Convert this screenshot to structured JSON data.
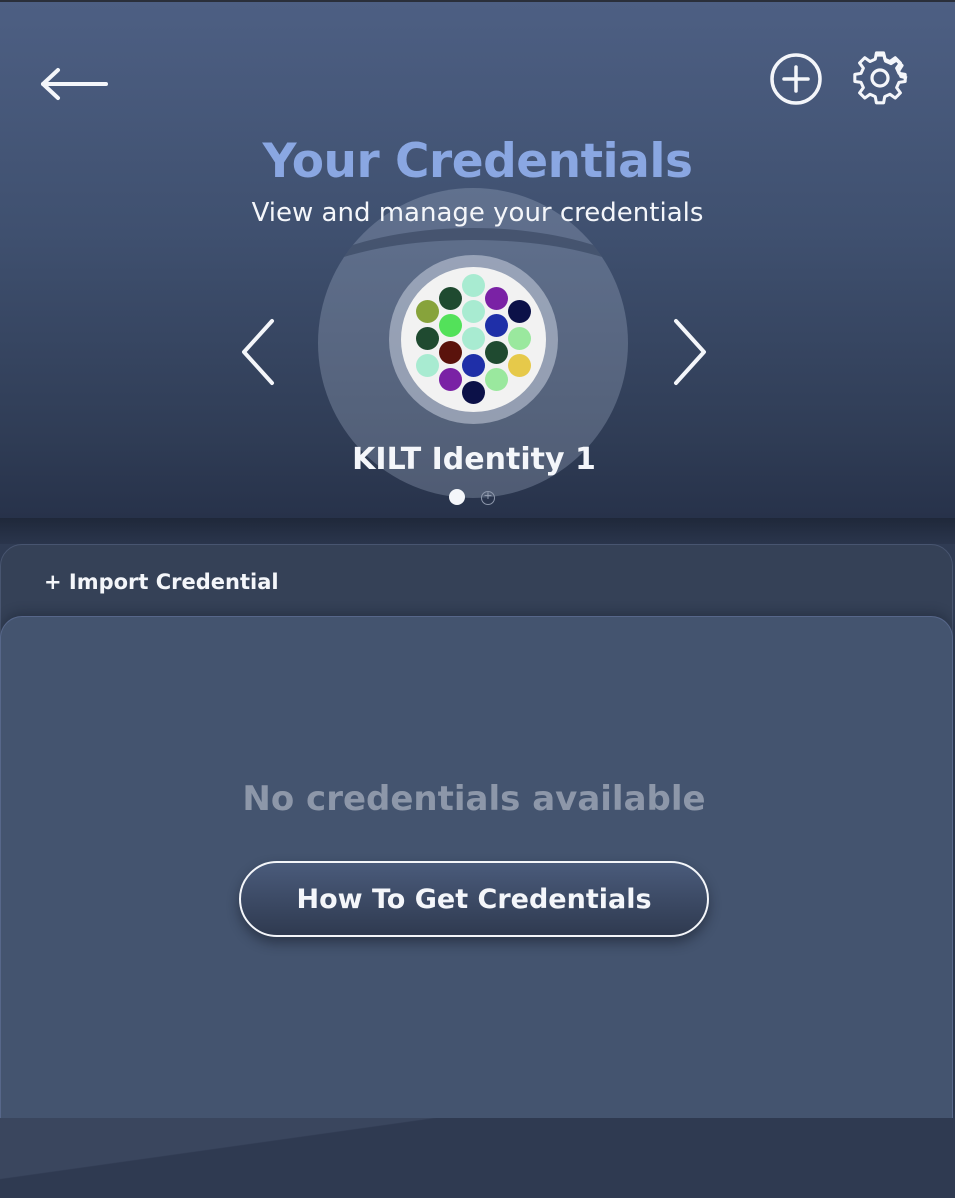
{
  "header": {
    "title": "Your Credentials",
    "subtitle": "View and manage your credentials",
    "back_icon": "arrow-left-icon",
    "add_icon": "plus-circle-icon",
    "settings_icon": "gear-icon"
  },
  "identity": {
    "name": "KILT Identity 1",
    "avatar_dots": [
      "#a8ebd1",
      "#1f4a30",
      "#87a33b",
      "#a8ebd1",
      "#7a22a5",
      "#0c1148",
      "#1f4a30",
      "#53e15a",
      "#a8ebd1",
      "#1f2fa8",
      "#5a130c",
      "#9ae89e",
      "#a8ebd1",
      "#a8ebd1",
      "#1f4a30",
      "#e6c94a",
      "#7a22a5",
      "#1f2fa8",
      "#9ae89e",
      "#0c1148"
    ],
    "pager_count": 2,
    "pager_active": 1
  },
  "credentials": {
    "import_label": "+ Import Credential",
    "empty_text": "No credentials available",
    "howto_label": "How To Get Credentials"
  },
  "colors": {
    "title_accent": "#8aa7e2",
    "header_top": "#4d5f83",
    "card_bg": "#44546f",
    "muted_text": "#8d97a9"
  }
}
